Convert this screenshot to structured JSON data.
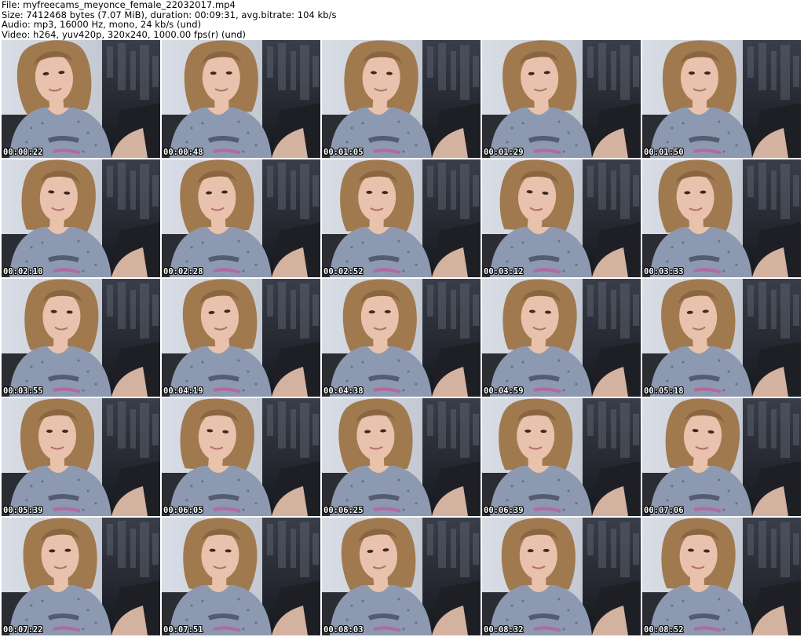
{
  "header": {
    "file_line": "File: myfreecams_meyonce_female_22032017.mp4",
    "size_line": "Size: 7412468 bytes (7.07 MiB), duration: 00:09:31, avg.bitrate: 104 kb/s",
    "audio_line": "Audio: mp3, 16000 Hz, mono, 24 kb/s (und)",
    "video_line": "Video: h264, yuv420p, 320x240, 1000.00 fps(r) (und)"
  },
  "thumbnails": [
    {
      "timestamp": "00:00:22"
    },
    {
      "timestamp": "00:00:48"
    },
    {
      "timestamp": "00:01:05"
    },
    {
      "timestamp": "00:01:29"
    },
    {
      "timestamp": "00:01:50"
    },
    {
      "timestamp": "00:02:10"
    },
    {
      "timestamp": "00:02:28"
    },
    {
      "timestamp": "00:02:52"
    },
    {
      "timestamp": "00:03:12"
    },
    {
      "timestamp": "00:03:33"
    },
    {
      "timestamp": "00:03:55"
    },
    {
      "timestamp": "00:04:19"
    },
    {
      "timestamp": "00:04:38"
    },
    {
      "timestamp": "00:04:59"
    },
    {
      "timestamp": "00:05:18"
    },
    {
      "timestamp": "00:05:39"
    },
    {
      "timestamp": "00:06:05"
    },
    {
      "timestamp": "00:06:25"
    },
    {
      "timestamp": "00:06:39"
    },
    {
      "timestamp": "00:07:06"
    },
    {
      "timestamp": "00:07:22"
    },
    {
      "timestamp": "00:07:51"
    },
    {
      "timestamp": "00:08:03"
    },
    {
      "timestamp": "00:08:32"
    },
    {
      "timestamp": "00:08:52"
    }
  ],
  "colors": {
    "background": "#ffffff",
    "header_text": "#000000",
    "timestamp_text": "#ffffff",
    "timestamp_outline": "#000000",
    "wall_left": "#d9dde6",
    "window_dark": "#2a2d36",
    "shirt": "#8d99b0",
    "skin": "#e8c2ad",
    "hair": "#a07a4e"
  }
}
